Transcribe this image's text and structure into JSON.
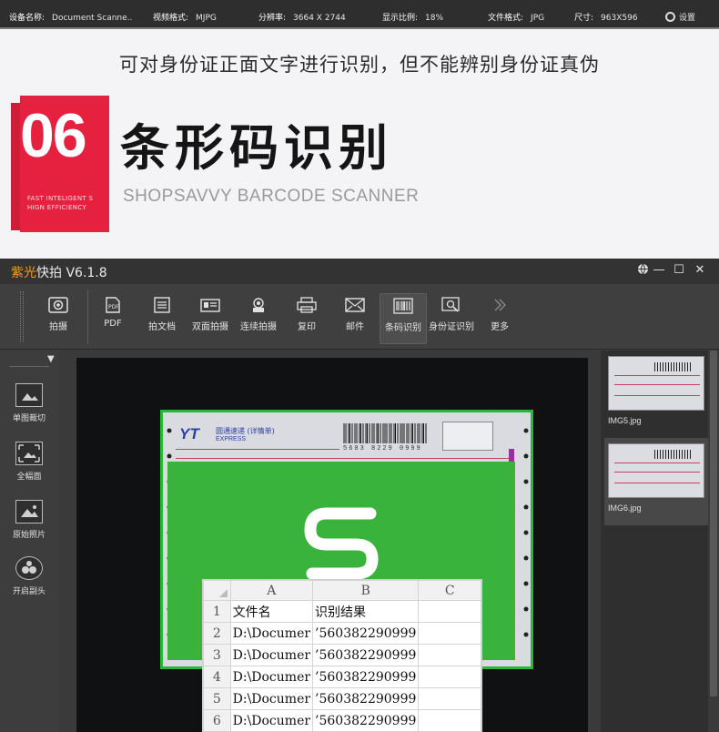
{
  "status_bar": {
    "device_label": "设备名称:",
    "device_value": "Document Scanne..",
    "video_label": "视频格式:",
    "video_value": "MJPG",
    "resolution_label": "分辨率:",
    "resolution_value": "3664 X 2744",
    "zoom_label": "显示比例:",
    "zoom_value": "18%",
    "fileformat_label": "文件格式:",
    "fileformat_value": "JPG",
    "size_label": "尺寸:",
    "size_value": "963X596",
    "settings_label": "设置"
  },
  "banner": {
    "subtitle": "可对身份证正面文字进行识别，但不能辨别身份证真伪",
    "number": "06",
    "tagline_1": "FAST INTELIGENT S",
    "tagline_2": "HIGN EFFICIENCY",
    "title": "条形码识别",
    "title_en": "SHOPSAVVY BARCODE SCANNER",
    "accent_color": "#e6213f"
  },
  "app": {
    "name_orange": "紫光",
    "name_white": "快拍",
    "version": "V6.1.8",
    "toolbar": [
      {
        "label": "拍摄",
        "icon": "camera-icon"
      },
      {
        "label": "PDF",
        "icon": "pdf-icon"
      },
      {
        "label": "拍文档",
        "icon": "document-icon"
      },
      {
        "label": "双面拍摄",
        "icon": "id-card-icon"
      },
      {
        "label": "连续拍摄",
        "icon": "burst-camera-icon"
      },
      {
        "label": "复印",
        "icon": "printer-icon"
      },
      {
        "label": "邮件",
        "icon": "mail-icon"
      },
      {
        "label": "条码识别",
        "icon": "barcode-icon"
      },
      {
        "label": "身份证识别",
        "icon": "id-scan-icon"
      },
      {
        "label": "更多",
        "icon": "more-chevron-icon"
      }
    ],
    "left_tools": [
      {
        "label": "单图裁切",
        "icon": "crop-image-icon"
      },
      {
        "label": "全幅面",
        "icon": "full-frame-icon"
      },
      {
        "label": "原始照片",
        "icon": "original-photo-icon"
      },
      {
        "label": "开启副头",
        "icon": "secondary-camera-icon"
      }
    ],
    "thumbnails": [
      {
        "caption": "IMG5.jpg"
      },
      {
        "caption": "IMG6.jpg"
      }
    ],
    "document": {
      "logo_mark": "YT",
      "logo_cn": "圆通速递",
      "logo_tag": "(详情单)",
      "logo_en": "EXPRESS",
      "barcode_number": "5603 8229 0999"
    }
  },
  "spreadsheet": {
    "columns": [
      "A",
      "B",
      "C"
    ],
    "rows": [
      {
        "n": "1",
        "a": "文件名",
        "b": "识别结果",
        "c": ""
      },
      {
        "n": "2",
        "a": "D:\\Documer",
        "b": "’560382290999",
        "c": ""
      },
      {
        "n": "3",
        "a": "D:\\Documer",
        "b": "’560382290999",
        "c": ""
      },
      {
        "n": "4",
        "a": "D:\\Documer",
        "b": "’560382290999",
        "c": ""
      },
      {
        "n": "5",
        "a": "D:\\Documer",
        "b": "’560382290999",
        "c": ""
      },
      {
        "n": "6",
        "a": "D:\\Documer",
        "b": "’560382290999",
        "c": ""
      }
    ]
  }
}
